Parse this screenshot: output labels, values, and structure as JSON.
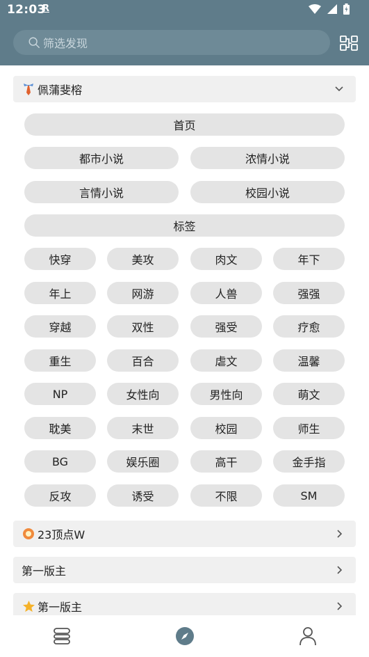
{
  "status": {
    "time": "12:03",
    "badge": "R"
  },
  "search": {
    "placeholder": "筛选发现"
  },
  "groups": [
    {
      "title": "佩蒲斐榕",
      "icon": "tie-icon",
      "expanded": true
    },
    {
      "title": "23顶点W",
      "icon": "flower-icon",
      "expanded": false
    },
    {
      "title": "第一版主",
      "icon": "",
      "expanded": false
    },
    {
      "title": "第一版主",
      "icon": "star-icon",
      "expanded": false
    }
  ],
  "wide_chips": [
    "首页",
    "都市小说",
    "浓情小说",
    "言情小说",
    "校园小说",
    "标签"
  ],
  "tags": [
    "快穿",
    "美攻",
    "肉文",
    "年下",
    "年上",
    "网游",
    "人兽",
    "强强",
    "穿越",
    "双性",
    "强受",
    "疗愈",
    "重生",
    "百合",
    "虐文",
    "温馨",
    "NP",
    "女性向",
    "男性向",
    "萌文",
    "耽美",
    "末世",
    "校园",
    "师生",
    "BG",
    "娱乐圈",
    "高干",
    "金手指",
    "反攻",
    "诱受",
    "不限",
    "SM"
  ],
  "colors": {
    "header": "#5f7c8a",
    "chip": "#e4e4e4",
    "group_header": "#f0f0f0",
    "active_nav": "#5f7c8a"
  },
  "bottom_nav": [
    {
      "icon": "bookshelf-icon",
      "active": false
    },
    {
      "icon": "compass-icon",
      "active": true
    },
    {
      "icon": "person-icon",
      "active": false
    }
  ]
}
